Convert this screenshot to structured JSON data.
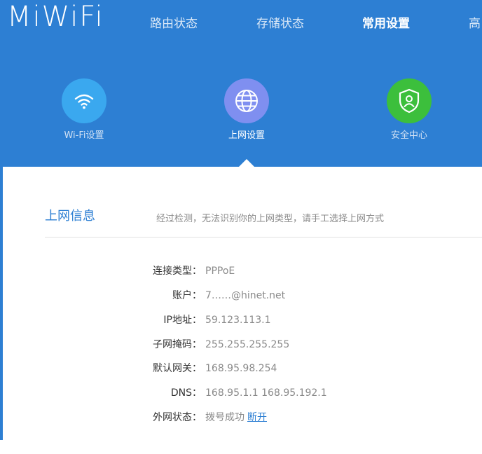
{
  "brand": {
    "logo_text": "MiWiFi",
    "header_color": "#2d7fd3"
  },
  "nav": {
    "items": [
      {
        "label": "路由状态",
        "active": false
      },
      {
        "label": "存储状态",
        "active": false
      },
      {
        "label": "常用设置",
        "active": true
      },
      {
        "label": "高",
        "active": false
      }
    ]
  },
  "settings_icons": [
    {
      "label": "Wi-Fi设置",
      "icon": "wifi-icon",
      "color": "#3aa8ef",
      "active": false
    },
    {
      "label": "上网设置",
      "icon": "globe-icon",
      "color": "#7f8ff0",
      "active": true
    },
    {
      "label": "安全中心",
      "icon": "shield-user-icon",
      "color": "#3cbf3c",
      "active": false
    }
  ],
  "section": {
    "title": "上网信息",
    "description": "经过检测，无法识别你的上网类型，请手工选择上网方式"
  },
  "info": {
    "rows": [
      {
        "label": "连接类型：",
        "value": "PPPoE"
      },
      {
        "label": "账户：",
        "value": "7‥‥‥@hinet.net"
      },
      {
        "label": "IP地址：",
        "value": "59.123.113.1"
      },
      {
        "label": "子网掩码：",
        "value": "255.255.255.255"
      },
      {
        "label": "默认网关：",
        "value": "168.95.98.254"
      },
      {
        "label": "DNS：",
        "value": "168.95.1.1 168.95.192.1"
      },
      {
        "label": "外网状态：",
        "value": "拨号成功",
        "link": "断开"
      }
    ]
  },
  "colors": {
    "link": "#2d7fd3",
    "label_text": "#333333",
    "value_text": "#8a8a8a"
  }
}
